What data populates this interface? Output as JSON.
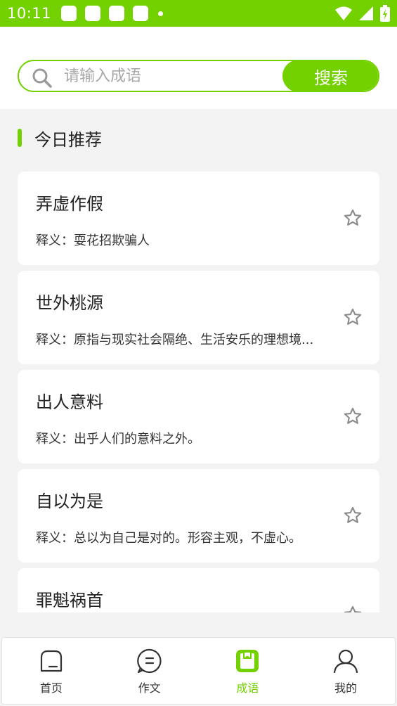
{
  "status_bar": {
    "time": "10:11"
  },
  "search": {
    "placeholder": "请输入成语",
    "value": "",
    "button_label": "搜索"
  },
  "section": {
    "title": "今日推荐"
  },
  "idioms": [
    {
      "title": "弄虚作假",
      "desc": "释义：耍花招欺骗人"
    },
    {
      "title": "世外桃源",
      "desc": "释义：原指与现实社会隔绝、生活安乐的理想境..."
    },
    {
      "title": "出人意料",
      "desc": "释义：出乎人们的意料之外。"
    },
    {
      "title": "自以为是",
      "desc": "释义：总以为自己是对的。形容主观，不虚心。"
    },
    {
      "title": "罪魁祸首",
      "desc": ""
    }
  ],
  "tabs": [
    {
      "label": "首页",
      "icon": "home-icon",
      "active": false
    },
    {
      "label": "作文",
      "icon": "chat-icon",
      "active": false
    },
    {
      "label": "成语",
      "icon": "book-icon",
      "active": true
    },
    {
      "label": "我的",
      "icon": "user-icon",
      "active": false
    }
  ],
  "colors": {
    "accent": "#73d100",
    "background": "#f3f3f3",
    "card": "#ffffff"
  }
}
